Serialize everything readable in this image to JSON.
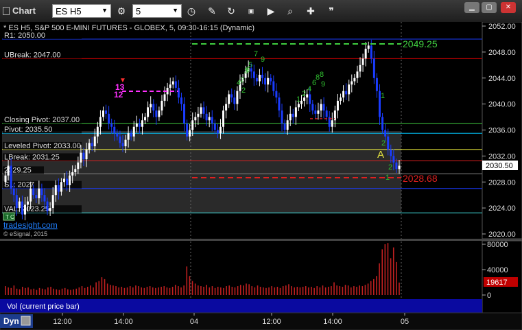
{
  "window": {
    "title": "Chart",
    "symbol": "ES H5",
    "interval": "5",
    "toolbar_icons": [
      "settings-icon",
      "clock-icon",
      "pencil-icon",
      "cursor-icon",
      "image-icon",
      "play-icon",
      "zoom-icon",
      "cross-icon",
      "quote-icon"
    ]
  },
  "chart": {
    "header": "* ES H5, S&P 500 E-MINI FUTURES - GLOBEX, 5, 09:30-16:15 (Dynamic)",
    "price_axis_ticks": [
      "2052.00",
      "2048.00",
      "2044.00",
      "2040.00",
      "2036.00",
      "2032.00",
      "2028.00",
      "2024.00",
      "2020.00"
    ],
    "current_price": "2030.50",
    "volume_axis_ticks": [
      "80000",
      "40000",
      "0"
    ],
    "current_volume": "19617",
    "time_axis_ticks": [
      "12:00",
      "14:00",
      "04",
      "12:00",
      "14:00",
      "05"
    ],
    "watermark": "tradesight.com",
    "copyright": "© eSignal, 2015",
    "volume_label": "Vol (current price bar)",
    "bottom_label": "Dyn",
    "level_labels": {
      "r1": "R1: 2050.00",
      "ubreak": "UBreak: 2047.00",
      "closing_pivot": "Closing Pivot: 2037.00",
      "pivot": "Pivot: 2035.50",
      "leveled_pivot": "Leveled Pivot: 2033.00",
      "lbreak": "LBreak: 2031.25",
      "level_2029": "2029.25",
      "s1": "S1: 2027",
      "val": "VAL: 2023.25",
      "high_marker": "2049.25",
      "low_marker": "2028.68"
    },
    "annotations": {
      "magenta_13": "13",
      "magenta_12": "12",
      "seq_top": [
        "7",
        "5",
        "3",
        "2",
        "9",
        "8",
        "6",
        "4",
        "2",
        "1",
        "8",
        "9",
        "6",
        "4",
        "2",
        "1"
      ],
      "a_label": "A",
      "seq_bottom": [
        "2",
        "2",
        "1"
      ]
    },
    "colors": {
      "background": "#000000",
      "up_candle": "#ffffff",
      "down_candle": "#1a3cff",
      "r1": "#1a3cff",
      "ubreak": "#c00000",
      "closing_pivot": "#40d040",
      "pivot": "#00c8ff",
      "leveled_pivot": "#ffff40",
      "lbreak": "#e02020",
      "s1": "#1a3cff",
      "val": "#40e0e0",
      "high_marker": "#40d040",
      "low_marker": "#e02020",
      "magenta": "#ff30ff",
      "volume": "#c02020"
    }
  },
  "chart_data": [
    {
      "type": "candlestick",
      "title": "* ES H5, S&P 500 E-MINI FUTURES - GLOBEX, 5, 09:30-16:15 (Dynamic)",
      "ylim": [
        2020,
        2053
      ],
      "levels": [
        {
          "name": "R1",
          "value": 2050.0
        },
        {
          "name": "UBreak",
          "value": 2047.0
        },
        {
          "name": "Closing Pivot",
          "value": 2037.0
        },
        {
          "name": "Pivot",
          "value": 2035.5
        },
        {
          "name": "Leveled Pivot",
          "value": 2033.0
        },
        {
          "name": "LBreak",
          "value": 2031.25
        },
        {
          "name": "",
          "value": 2029.25
        },
        {
          "name": "S1",
          "value": 2027.0
        },
        {
          "name": "VAL",
          "value": 2023.25
        }
      ],
      "closes": [
        2029,
        2030.5,
        2027,
        2026,
        2024,
        2025,
        2023,
        2024.5,
        2025,
        2027,
        2026,
        2025.5,
        2027,
        2026,
        2025,
        2023.5,
        2024,
        2026,
        2027.5,
        2026.5,
        2028,
        2028.5,
        2027.5,
        2029,
        2029.5,
        2030,
        2031,
        2032.5,
        2031.5,
        2033,
        2034,
        2033.5,
        2035,
        2036.5,
        2038,
        2039,
        2038.5,
        2037,
        2036.5,
        2035.5,
        2035,
        2034,
        2033.5,
        2034.5,
        2035.5,
        2035,
        2036.5,
        2037,
        2036.5,
        2037.5,
        2038,
        2039.5,
        2040,
        2039,
        2038,
        2039,
        2040.5,
        2041.5,
        2042.5,
        2043,
        2043.5,
        2042.5,
        2041,
        2040,
        2037,
        2035,
        2036,
        2037.5,
        2038,
        2038.5,
        2039.5,
        2038.5,
        2037.5,
        2038,
        2037,
        2036,
        2035.5,
        2036.5,
        2039,
        2040,
        2041.5,
        2041,
        2040,
        2042,
        2043.5,
        2044,
        2045,
        2045.5,
        2045,
        2044,
        2043.5,
        2044.5,
        2044,
        2043,
        2044,
        2043.5,
        2042,
        2041,
        2039,
        2037,
        2036,
        2037.5,
        2038.5,
        2038,
        2039.5,
        2040,
        2040.5,
        2041,
        2041.5,
        2040,
        2039,
        2038.5,
        2039,
        2040,
        2039,
        2038,
        2036.5,
        2037.5,
        2039,
        2040.5,
        2041,
        2042,
        2041.5,
        2043,
        2043.5,
        2044,
        2045,
        2046,
        2047,
        2048.5,
        2049,
        2047,
        2044,
        2042,
        2038,
        2036,
        2035,
        2033,
        2032,
        2031,
        2030,
        2030.5
      ]
    },
    {
      "type": "bar",
      "title": "Vol (current price bar)",
      "ylim": [
        0,
        90000
      ],
      "values": [
        14000,
        12000,
        11000,
        15000,
        10000,
        9000,
        13000,
        11000,
        12000,
        9000,
        10000,
        8000,
        11000,
        10000,
        9000,
        12000,
        13000,
        10000,
        9000,
        8000,
        10000,
        11000,
        9000,
        8000,
        9000,
        10000,
        12000,
        14000,
        11000,
        13000,
        15000,
        12000,
        20000,
        22000,
        28000,
        25000,
        18000,
        16000,
        15000,
        14000,
        12000,
        13000,
        11000,
        12000,
        14000,
        12000,
        15000,
        14000,
        12000,
        11000,
        13000,
        14000,
        12000,
        11000,
        12000,
        13000,
        14000,
        12000,
        11000,
        13000,
        16000,
        14000,
        12000,
        15000,
        45000,
        30000,
        22000,
        18000,
        15000,
        14000,
        13000,
        16000,
        12000,
        14000,
        11000,
        13000,
        12000,
        11000,
        14000,
        15000,
        13000,
        12000,
        14000,
        16000,
        15000,
        18000,
        17000,
        14000,
        12000,
        15000,
        13000,
        12000,
        11000,
        12000,
        14000,
        12000,
        13000,
        11000,
        14000,
        15000,
        17000,
        14000,
        12000,
        13000,
        12000,
        13000,
        14000,
        12000,
        13000,
        11000,
        14000,
        12000,
        15000,
        12000,
        13000,
        14000,
        20000,
        15000,
        14000,
        13000,
        16000,
        15000,
        12000,
        14000,
        13000,
        15000,
        14000,
        16000,
        18000,
        22000,
        25000,
        30000,
        50000,
        72000,
        80000,
        82000,
        58000,
        75000,
        52000,
        19617
      ]
    }
  ]
}
